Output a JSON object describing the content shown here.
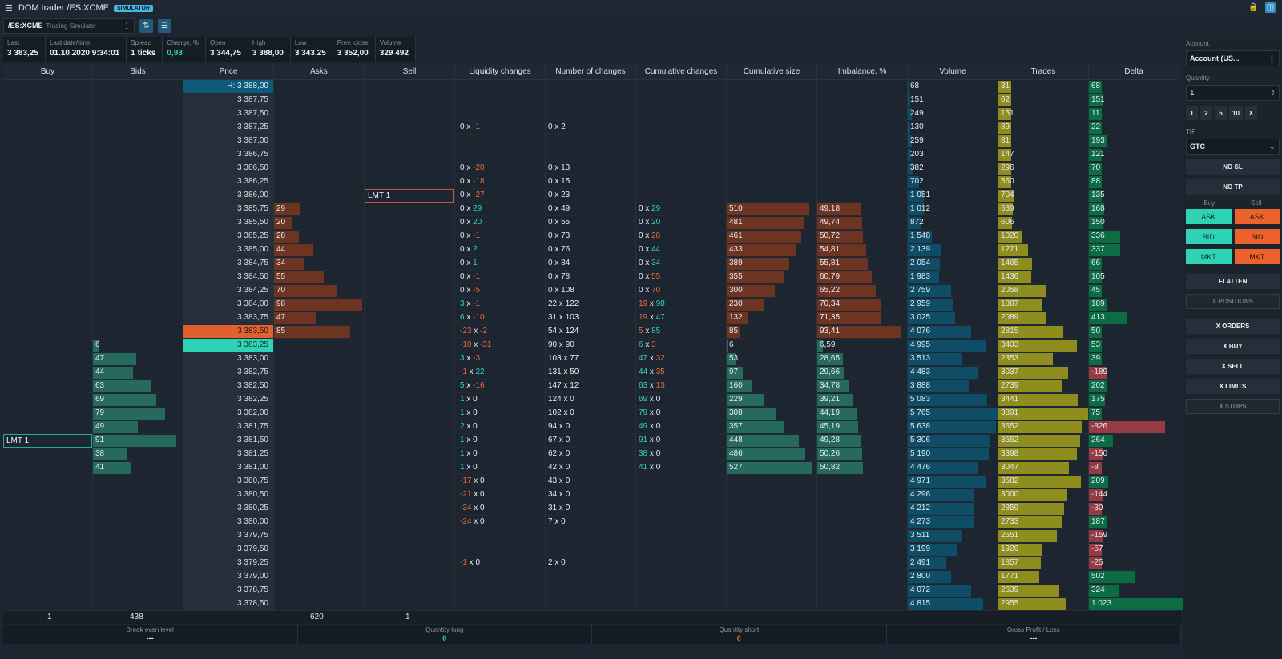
{
  "window": {
    "menu_icon": "hamburger-icon",
    "title": "DOM trader /ES:XCME",
    "badge": "SIMULATOR",
    "lock_icon": "lock-icon",
    "panel_icon": "panel-toggle-icon"
  },
  "toolbar": {
    "symbol": "/ES:XCME",
    "symbol_desc": "Trading Simulator",
    "more_icon": "more-vertical-icon",
    "btn1_icon": "center-price-icon",
    "btn2_icon": "settings-sliders-icon"
  },
  "stats": [
    {
      "label": "Last",
      "value": "3 383,25"
    },
    {
      "label": "Last date/time",
      "value": "01.10.2020 9:34:01"
    },
    {
      "label": "Spread",
      "value": "1 ticks"
    },
    {
      "label": "Change, %",
      "value": "0,93"
    },
    {
      "label": "Open",
      "value": "3 344,75"
    },
    {
      "label": "High",
      "value": "3 388,00"
    },
    {
      "label": "Low",
      "value": "3 343,25"
    },
    {
      "label": "Prev. close",
      "value": "3 352,00"
    },
    {
      "label": "Volume",
      "value": "329 492"
    }
  ],
  "columns": [
    "Buy",
    "Bids",
    "Price",
    "Asks",
    "Sell",
    "Liquidity changes",
    "Number of changes",
    "Cumulative changes",
    "Cumulative size",
    "Imbalance, %",
    "Volume",
    "Trades",
    "Delta"
  ],
  "colors": {
    "ask": "#e0602e",
    "bid": "#2ed3b6",
    "high": "#0d5a79",
    "volume": "#0f4d66",
    "trades": "#8e8d1d",
    "delta_pos": "#0c6d45",
    "delta_neg": "#963a43",
    "ask_bar": "#6e3422",
    "bid_bar": "#25695f"
  },
  "rows": [
    {
      "price": "H: 3 388,00",
      "volume": "68",
      "trades": "31",
      "delta": "68"
    },
    {
      "price": "3 387,75",
      "volume": "151",
      "trades": "62",
      "delta": "151"
    },
    {
      "price": "3 387,50",
      "volume": "249",
      "trades": "151",
      "delta": "11"
    },
    {
      "price": "3 387,25",
      "liq_a": "0",
      "liq_b": "-1",
      "num_a": "0",
      "num_b": "2",
      "volume": "130",
      "trades": "89",
      "delta": "22"
    },
    {
      "price": "3 387,00",
      "volume": "259",
      "trades": "81",
      "delta": "193"
    },
    {
      "price": "3 386,75",
      "volume": "203",
      "trades": "147",
      "delta": "121"
    },
    {
      "price": "3 386,50",
      "liq_a": "0",
      "liq_b": "-20",
      "num_a": "0",
      "num_b": "13",
      "volume": "382",
      "trades": "296",
      "delta": "70"
    },
    {
      "price": "3 386,25",
      "liq_a": "0",
      "liq_b": "-18",
      "num_a": "0",
      "num_b": "15",
      "volume": "702",
      "trades": "560",
      "delta": "88"
    },
    {
      "price": "3 386,00",
      "sell": "LMT  1",
      "liq_a": "0",
      "liq_b": "-27",
      "num_a": "0",
      "num_b": "23",
      "volume": "1 051",
      "trades": "704",
      "delta": "135"
    },
    {
      "price": "3 385,75",
      "ask": "29",
      "liq_a": "0",
      "liq_b": "29",
      "num_a": "0",
      "num_b": "49",
      "cum_a": "0",
      "cum_b": "29",
      "cumsize": "510",
      "imb": "49,18",
      "volume": "1 012",
      "trades": "639",
      "delta": "168"
    },
    {
      "price": "3 385,50",
      "ask": "20",
      "liq_a": "0",
      "liq_b": "20",
      "num_a": "0",
      "num_b": "55",
      "cum_a": "0",
      "cum_b": "20",
      "cumsize": "481",
      "imb": "49,74",
      "volume": "872",
      "trades": "606",
      "delta": "150"
    },
    {
      "price": "3 385,25",
      "ask": "28",
      "liq_a": "0",
      "liq_b": "-1",
      "num_a": "0",
      "num_b": "73",
      "cum_a": "0",
      "cum_b": "28",
      "cumsize": "461",
      "imb": "50,72",
      "volume": "1 548",
      "trades": "1020",
      "delta": "336"
    },
    {
      "price": "3 385,00",
      "ask": "44",
      "liq_a": "0",
      "liq_b": "2",
      "num_a": "0",
      "num_b": "76",
      "cum_a": "0",
      "cum_b": "44",
      "cumsize": "433",
      "imb": "54,81",
      "volume": "2 139",
      "trades": "1271",
      "delta": "337"
    },
    {
      "price": "3 384,75",
      "ask": "34",
      "liq_a": "0",
      "liq_b": "1",
      "num_a": "0",
      "num_b": "84",
      "cum_a": "0",
      "cum_b": "34",
      "cumsize": "389",
      "imb": "55,81",
      "volume": "2 054",
      "trades": "1465",
      "delta": "66"
    },
    {
      "price": "3 384,50",
      "ask": "55",
      "liq_a": "0",
      "liq_b": "-1",
      "num_a": "0",
      "num_b": "78",
      "cum_a": "0",
      "cum_b": "55",
      "cumsize": "355",
      "imb": "60,79",
      "volume": "1 983",
      "trades": "1436",
      "delta": "105"
    },
    {
      "price": "3 384,25",
      "ask": "70",
      "liq_a": "0",
      "liq_b": "-5",
      "num_a": "0",
      "num_b": "108",
      "cum_a": "0",
      "cum_b": "70",
      "cumsize": "300",
      "imb": "65,22",
      "volume": "2 759",
      "trades": "2058",
      "delta": "45"
    },
    {
      "price": "3 384,00",
      "ask": "98",
      "liq_a": "3",
      "liq_b": "-1",
      "num_a": "22",
      "num_b": "122",
      "cum_a": "19",
      "cum_b": "98",
      "cumsize": "230",
      "imb": "70,34",
      "volume": "2 959",
      "trades": "1887",
      "delta": "189"
    },
    {
      "price": "3 383,75",
      "ask": "47",
      "liq_a": "6",
      "liq_b": "-10",
      "num_a": "31",
      "num_b": "103",
      "cum_a": "19",
      "cum_b": "47",
      "cumsize": "132",
      "imb": "71,35",
      "volume": "3 025",
      "trades": "2089",
      "delta": "413"
    },
    {
      "price": "3 383,50",
      "ask": "85",
      "liq_a": "-23",
      "liq_b": "-2",
      "num_a": "54",
      "num_b": "124",
      "cum_a": "5",
      "cum_b": "85",
      "cumsize": "85",
      "imb": "93,41",
      "volume": "4 076",
      "trades": "2815",
      "delta": "50"
    },
    {
      "price": "3 383,25",
      "bid": "6",
      "liq_a": "-10",
      "liq_b": "-31",
      "num_a": "90",
      "num_b": "90",
      "cum_a": "6",
      "cum_b": "3",
      "cumsize": "6",
      "imb": "6,59",
      "volume": "4 995",
      "trades": "3403",
      "delta": "53"
    },
    {
      "price": "3 383,00",
      "bid": "47",
      "liq_a": "3",
      "liq_b": "-3",
      "num_a": "103",
      "num_b": "77",
      "cum_a": "47",
      "cum_b": "32",
      "cumsize": "53",
      "imb": "28,65",
      "volume": "3 513",
      "trades": "2353",
      "delta": "39"
    },
    {
      "price": "3 382,75",
      "bid": "44",
      "liq_a": "-1",
      "liq_b": "22",
      "num_a": "131",
      "num_b": "50",
      "cum_a": "44",
      "cum_b": "35",
      "cumsize": "97",
      "imb": "29,66",
      "volume": "4 483",
      "trades": "3037",
      "delta": "-189"
    },
    {
      "price": "3 382,50",
      "bid": "63",
      "liq_a": "5",
      "liq_b": "-16",
      "num_a": "147",
      "num_b": "12",
      "cum_a": "63",
      "cum_b": "13",
      "cumsize": "160",
      "imb": "34,78",
      "volume": "3 888",
      "trades": "2739",
      "delta": "202"
    },
    {
      "price": "3 382,25",
      "bid": "69",
      "liq_a": "1",
      "liq_b": "0",
      "num_a": "124",
      "num_b": "0",
      "cum_a": "69",
      "cum_b": "0",
      "cumsize": "229",
      "imb": "39,21",
      "volume": "5 083",
      "trades": "3441",
      "delta": "175"
    },
    {
      "price": "3 382,00",
      "bid": "79",
      "liq_a": "1",
      "liq_b": "0",
      "num_a": "102",
      "num_b": "0",
      "cum_a": "79",
      "cum_b": "0",
      "cumsize": "308",
      "imb": "44,19",
      "volume": "5 765",
      "trades": "3891",
      "delta": "75"
    },
    {
      "price": "3 381,75",
      "bid": "49",
      "liq_a": "2",
      "liq_b": "0",
      "num_a": "94",
      "num_b": "0",
      "cum_a": "49",
      "cum_b": "0",
      "cumsize": "357",
      "imb": "45,19",
      "volume": "5 638",
      "trades": "3652",
      "delta": "-826"
    },
    {
      "price": "3 381,50",
      "buy": "LMT  1",
      "bid": "91",
      "liq_a": "1",
      "liq_b": "0",
      "num_a": "67",
      "num_b": "0",
      "cum_a": "91",
      "cum_b": "0",
      "cumsize": "448",
      "imb": "49,28",
      "volume": "5 306",
      "trades": "3552",
      "delta": "264"
    },
    {
      "price": "3 381,25",
      "bid": "38",
      "liq_a": "1",
      "liq_b": "0",
      "num_a": "62",
      "num_b": "0",
      "cum_a": "38",
      "cum_b": "0",
      "cumsize": "486",
      "imb": "50,26",
      "volume": "5 190",
      "trades": "3398",
      "delta": "-150"
    },
    {
      "price": "3 381,00",
      "bid": "41",
      "liq_a": "1",
      "liq_b": "0",
      "num_a": "42",
      "num_b": "0",
      "cum_a": "41",
      "cum_b": "0",
      "cumsize": "527",
      "imb": "50,82",
      "volume": "4 476",
      "trades": "3047",
      "delta": "-8"
    },
    {
      "price": "3 380,75",
      "liq_a": "-17",
      "liq_b": "0",
      "num_a": "43",
      "num_b": "0",
      "volume": "4 971",
      "trades": "3582",
      "delta": "209"
    },
    {
      "price": "3 380,50",
      "liq_a": "-21",
      "liq_b": "0",
      "num_a": "34",
      "num_b": "0",
      "volume": "4 296",
      "trades": "3000",
      "delta": "-144"
    },
    {
      "price": "3 380,25",
      "liq_a": "-34",
      "liq_b": "0",
      "num_a": "31",
      "num_b": "0",
      "volume": "4 212",
      "trades": "2859",
      "delta": "-30"
    },
    {
      "price": "3 380,00",
      "liq_a": "-24",
      "liq_b": "0",
      "num_a": "7",
      "num_b": "0",
      "volume": "4 273",
      "trades": "2733",
      "delta": "187"
    },
    {
      "price": "3 379,75",
      "volume": "3 511",
      "trades": "2551",
      "delta": "-159"
    },
    {
      "price": "3 379,50",
      "volume": "3 199",
      "trades": "1926",
      "delta": "-57"
    },
    {
      "price": "3 379,25",
      "liq_a": "-1",
      "liq_b": "0",
      "num_a": "2",
      "num_b": "0",
      "volume": "2 491",
      "trades": "1857",
      "delta": "-25"
    },
    {
      "price": "3 379,00",
      "volume": "2 800",
      "trades": "1771",
      "delta": "502"
    },
    {
      "price": "3 378,75",
      "volume": "4 072",
      "trades": "2639",
      "delta": "324"
    },
    {
      "price": "3 378,50",
      "volume": "4 815",
      "trades": "2955",
      "delta": "1 023"
    }
  ],
  "totals": {
    "buy": "1",
    "bids": "438",
    "asks": "620",
    "sell": "1"
  },
  "footer": [
    {
      "label": "Break even level",
      "value": "---"
    },
    {
      "label": "Quantity long",
      "value": "0"
    },
    {
      "label": "Quantity short",
      "value": "0"
    },
    {
      "label": "Gross Profit / Loss",
      "value": "---"
    }
  ],
  "side": {
    "account_label": "Account",
    "account_value": "Account (US...",
    "quantity_label": "Quantity",
    "quantity_value": "1",
    "qty_buttons": [
      "1",
      "2",
      "5",
      "10",
      "X"
    ],
    "tif_label": "TIF",
    "tif_value": "GTC",
    "no_sl": "NO SL",
    "no_tp": "NO TP",
    "buy_label": "Buy",
    "sell_label": "Sell",
    "buy_ask": "ASK",
    "sell_ask": "ASK",
    "buy_bid": "BID",
    "sell_bid": "BID",
    "buy_mkt": "MKT",
    "sell_mkt": "MKT",
    "flatten": "FLATTEN",
    "x_positions": "X POSITIONS",
    "x_orders": "X ORDERS",
    "x_buy": "X BUY",
    "x_sell": "X SELL",
    "x_limits": "X LIMITS",
    "x_stops": "X STOPS"
  }
}
